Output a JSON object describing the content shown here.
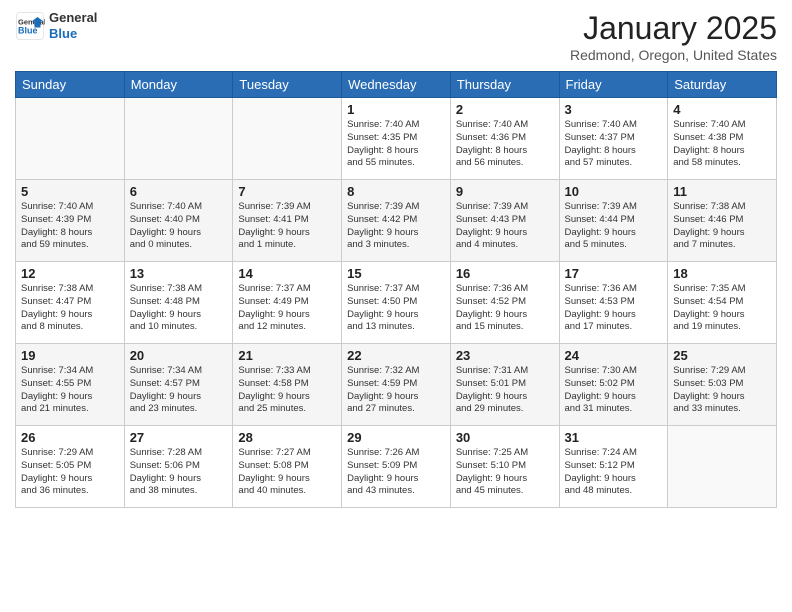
{
  "header": {
    "logo_general": "General",
    "logo_blue": "Blue",
    "month": "January 2025",
    "location": "Redmond, Oregon, United States"
  },
  "days_of_week": [
    "Sunday",
    "Monday",
    "Tuesday",
    "Wednesday",
    "Thursday",
    "Friday",
    "Saturday"
  ],
  "weeks": [
    [
      {
        "num": "",
        "info": ""
      },
      {
        "num": "",
        "info": ""
      },
      {
        "num": "",
        "info": ""
      },
      {
        "num": "1",
        "info": "Sunrise: 7:40 AM\nSunset: 4:35 PM\nDaylight: 8 hours\nand 55 minutes."
      },
      {
        "num": "2",
        "info": "Sunrise: 7:40 AM\nSunset: 4:36 PM\nDaylight: 8 hours\nand 56 minutes."
      },
      {
        "num": "3",
        "info": "Sunrise: 7:40 AM\nSunset: 4:37 PM\nDaylight: 8 hours\nand 57 minutes."
      },
      {
        "num": "4",
        "info": "Sunrise: 7:40 AM\nSunset: 4:38 PM\nDaylight: 8 hours\nand 58 minutes."
      }
    ],
    [
      {
        "num": "5",
        "info": "Sunrise: 7:40 AM\nSunset: 4:39 PM\nDaylight: 8 hours\nand 59 minutes."
      },
      {
        "num": "6",
        "info": "Sunrise: 7:40 AM\nSunset: 4:40 PM\nDaylight: 9 hours\nand 0 minutes."
      },
      {
        "num": "7",
        "info": "Sunrise: 7:39 AM\nSunset: 4:41 PM\nDaylight: 9 hours\nand 1 minute."
      },
      {
        "num": "8",
        "info": "Sunrise: 7:39 AM\nSunset: 4:42 PM\nDaylight: 9 hours\nand 3 minutes."
      },
      {
        "num": "9",
        "info": "Sunrise: 7:39 AM\nSunset: 4:43 PM\nDaylight: 9 hours\nand 4 minutes."
      },
      {
        "num": "10",
        "info": "Sunrise: 7:39 AM\nSunset: 4:44 PM\nDaylight: 9 hours\nand 5 minutes."
      },
      {
        "num": "11",
        "info": "Sunrise: 7:38 AM\nSunset: 4:46 PM\nDaylight: 9 hours\nand 7 minutes."
      }
    ],
    [
      {
        "num": "12",
        "info": "Sunrise: 7:38 AM\nSunset: 4:47 PM\nDaylight: 9 hours\nand 8 minutes."
      },
      {
        "num": "13",
        "info": "Sunrise: 7:38 AM\nSunset: 4:48 PM\nDaylight: 9 hours\nand 10 minutes."
      },
      {
        "num": "14",
        "info": "Sunrise: 7:37 AM\nSunset: 4:49 PM\nDaylight: 9 hours\nand 12 minutes."
      },
      {
        "num": "15",
        "info": "Sunrise: 7:37 AM\nSunset: 4:50 PM\nDaylight: 9 hours\nand 13 minutes."
      },
      {
        "num": "16",
        "info": "Sunrise: 7:36 AM\nSunset: 4:52 PM\nDaylight: 9 hours\nand 15 minutes."
      },
      {
        "num": "17",
        "info": "Sunrise: 7:36 AM\nSunset: 4:53 PM\nDaylight: 9 hours\nand 17 minutes."
      },
      {
        "num": "18",
        "info": "Sunrise: 7:35 AM\nSunset: 4:54 PM\nDaylight: 9 hours\nand 19 minutes."
      }
    ],
    [
      {
        "num": "19",
        "info": "Sunrise: 7:34 AM\nSunset: 4:55 PM\nDaylight: 9 hours\nand 21 minutes."
      },
      {
        "num": "20",
        "info": "Sunrise: 7:34 AM\nSunset: 4:57 PM\nDaylight: 9 hours\nand 23 minutes."
      },
      {
        "num": "21",
        "info": "Sunrise: 7:33 AM\nSunset: 4:58 PM\nDaylight: 9 hours\nand 25 minutes."
      },
      {
        "num": "22",
        "info": "Sunrise: 7:32 AM\nSunset: 4:59 PM\nDaylight: 9 hours\nand 27 minutes."
      },
      {
        "num": "23",
        "info": "Sunrise: 7:31 AM\nSunset: 5:01 PM\nDaylight: 9 hours\nand 29 minutes."
      },
      {
        "num": "24",
        "info": "Sunrise: 7:30 AM\nSunset: 5:02 PM\nDaylight: 9 hours\nand 31 minutes."
      },
      {
        "num": "25",
        "info": "Sunrise: 7:29 AM\nSunset: 5:03 PM\nDaylight: 9 hours\nand 33 minutes."
      }
    ],
    [
      {
        "num": "26",
        "info": "Sunrise: 7:29 AM\nSunset: 5:05 PM\nDaylight: 9 hours\nand 36 minutes."
      },
      {
        "num": "27",
        "info": "Sunrise: 7:28 AM\nSunset: 5:06 PM\nDaylight: 9 hours\nand 38 minutes."
      },
      {
        "num": "28",
        "info": "Sunrise: 7:27 AM\nSunset: 5:08 PM\nDaylight: 9 hours\nand 40 minutes."
      },
      {
        "num": "29",
        "info": "Sunrise: 7:26 AM\nSunset: 5:09 PM\nDaylight: 9 hours\nand 43 minutes."
      },
      {
        "num": "30",
        "info": "Sunrise: 7:25 AM\nSunset: 5:10 PM\nDaylight: 9 hours\nand 45 minutes."
      },
      {
        "num": "31",
        "info": "Sunrise: 7:24 AM\nSunset: 5:12 PM\nDaylight: 9 hours\nand 48 minutes."
      },
      {
        "num": "",
        "info": ""
      }
    ]
  ]
}
